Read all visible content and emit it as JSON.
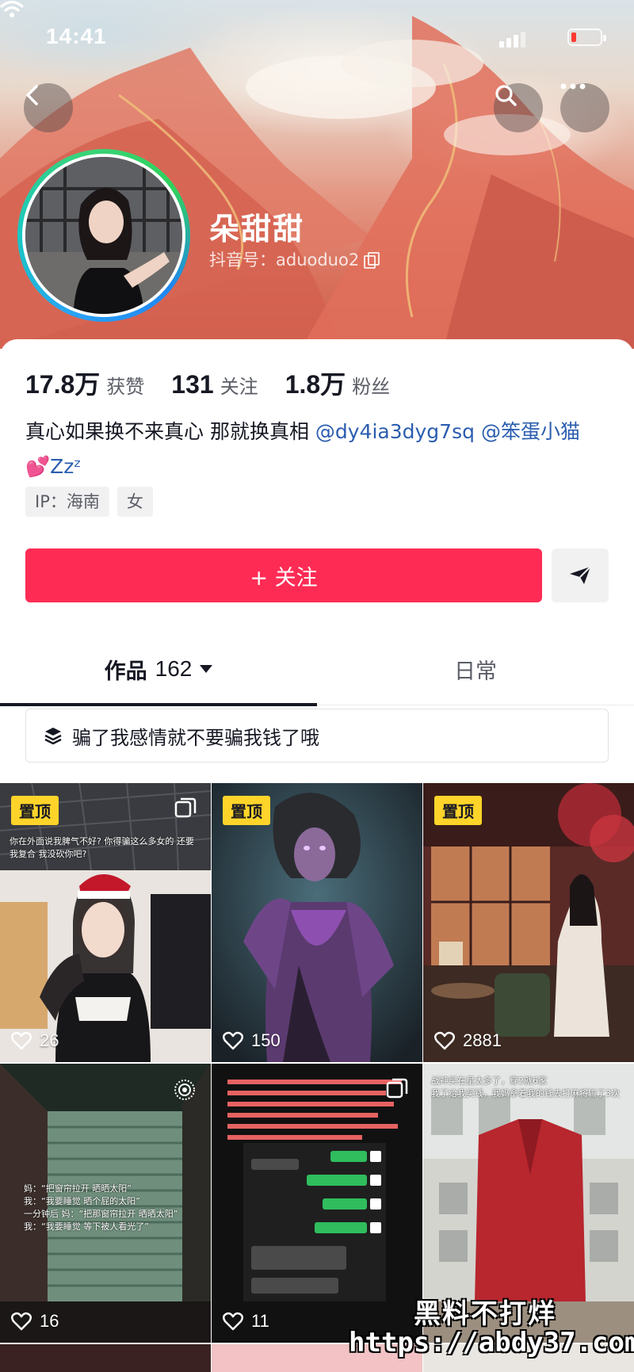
{
  "status_bar": {
    "time": "14:41"
  },
  "profile": {
    "name": "朵甜甜",
    "douyin_id": "抖音号：aduoduo2",
    "stats": [
      {
        "value": "17.8万",
        "label": "获赞"
      },
      {
        "value": "131",
        "label": "关注"
      },
      {
        "value": "1.8万",
        "label": "粉丝"
      }
    ],
    "bio_text": "真心如果换不来真心 那就换真相 ",
    "mention_1": "@dy4ia3dyg7sq",
    "mention_2": "@笨蛋小猫",
    "bio_emoji": "💕",
    "bio_tail": "Zzᶻ",
    "tags": [
      "IP：海南",
      "女"
    ]
  },
  "actions": {
    "follow_label": "+ 关注"
  },
  "tabs": {
    "works_label": "作品",
    "works_count": "162",
    "daily_label": "日常"
  },
  "collection": {
    "label": "骗了我感情就不要骗我钱了哦"
  },
  "posts": [
    {
      "pinned": "置顶",
      "likes": "26",
      "caption": "你在外面说我脾气不好?\n你得骗这么多女的 还要我复合 我没砍你吧?"
    },
    {
      "pinned": "置顶",
      "likes": "150"
    },
    {
      "pinned": "置顶",
      "likes": "2881"
    },
    {
      "likes": "16",
      "caption": "妈：“把窗帘拉开 晒晒太阳”\n我：“我要睡觉 晒个屁的太阳”\n一分钟后 妈：“把那窗帘拉开 晒晒太阳”\n我：“我要睡觉 等下被人看光了”"
    },
    {
      "likes": "11"
    },
    {
      "likes": "",
      "caption": "战神买在星太多了，穿2就6家\n我了给我买钱，我妈拿着我的钱去打麻将输了3次"
    }
  ],
  "watermark": {
    "line1": "黑料不打烊",
    "line2": "https://abdy37.com"
  },
  "colors": {
    "accent": "#fe2c55",
    "pin": "#ffd42a",
    "mention": "#2b5db0"
  }
}
